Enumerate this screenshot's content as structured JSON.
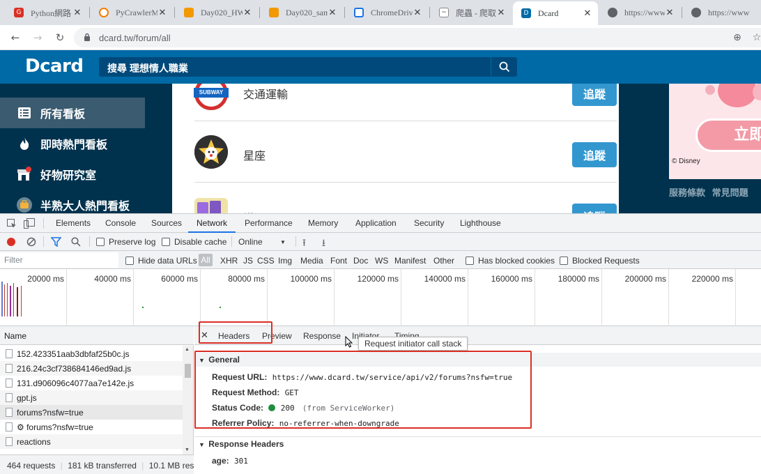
{
  "browser": {
    "tabs": [
      {
        "title": "Python網路",
        "color": "#d93025",
        "glyph": "G"
      },
      {
        "title": "PyCrawlerM",
        "color": "#f57c00",
        "glyph": "C"
      },
      {
        "title": "Day020_HW",
        "color": "#f29900",
        "glyph": "D"
      },
      {
        "title": "Day020_sam",
        "color": "#f29900",
        "glyph": "D"
      },
      {
        "title": "ChromeDriv",
        "color": "#1a73e8",
        "glyph": "□"
      },
      {
        "title": "爬蟲 - 爬取",
        "color": "#5f6368",
        "glyph": "~"
      },
      {
        "title": "Dcard",
        "color": "#006aa6",
        "glyph": "D"
      },
      {
        "title": "https://www",
        "color": "#5f6368",
        "glyph": "◎"
      },
      {
        "title": "https://www",
        "color": "#5f6368",
        "glyph": "◎"
      }
    ],
    "url": "dcard.tw/forum/all"
  },
  "site": {
    "logo": "Dcard",
    "search_value": "搜尋 理想情人職業",
    "sidebar": [
      {
        "label": "所有看板",
        "icon": "list-icon"
      },
      {
        "label": "即時熱門看板",
        "icon": "fire-icon"
      },
      {
        "label": "好物研究室",
        "icon": "shop-icon"
      },
      {
        "label": "半熟大人熱門看板",
        "icon": "briefcase-icon"
      }
    ],
    "forums": [
      {
        "name": "交通運輸",
        "follow": "追蹤",
        "icon": "subway-icon"
      },
      {
        "name": "星座",
        "follow": "追蹤",
        "icon": "zodiac-icon"
      },
      {
        "name": "塔羅",
        "follow": "追蹤",
        "icon": "tarot-icon"
      }
    ],
    "subway_badge": "SUBWAY",
    "ad": {
      "button": "立即",
      "copyright": "© Disney"
    },
    "footer_links": [
      "服務條款",
      "常見問題"
    ]
  },
  "devtools": {
    "tabs": [
      "Elements",
      "Console",
      "Sources",
      "Network",
      "Performance",
      "Memory",
      "Application",
      "Security",
      "Lighthouse"
    ],
    "active_tab": "Network",
    "toolbar": {
      "preserve_log": "Preserve log",
      "disable_cache": "Disable cache",
      "throttle": "Online"
    },
    "filter": {
      "placeholder": "Filter",
      "hide_data_urls": "Hide data URLs",
      "all": "All",
      "types": [
        "XHR",
        "JS",
        "CSS",
        "Img",
        "Media",
        "Font",
        "Doc",
        "WS",
        "Manifest",
        "Other"
      ],
      "has_blocked_cookies": "Has blocked cookies",
      "blocked_requests": "Blocked Requests"
    },
    "timeline_ticks": [
      "20000 ms",
      "40000 ms",
      "60000 ms",
      "80000 ms",
      "100000 ms",
      "120000 ms",
      "140000 ms",
      "160000 ms",
      "180000 ms",
      "200000 ms",
      "220000 ms"
    ],
    "requests_header": "Name",
    "requests": [
      "152.423351aab3dbfaf25b0c.js",
      "216.24c3cf738684146ed9ad.js",
      "131.d906096c4077aa7e142e.js",
      "gpt.js",
      "forums?nsfw=true",
      "⚙ forums?nsfw=true",
      "reactions"
    ],
    "status": {
      "requests": "464 requests",
      "transferred": "181 kB transferred",
      "resources": "10.1 MB res"
    },
    "detail_tabs": [
      "Headers",
      "Preview",
      "Response",
      "Initiator",
      "Timing"
    ],
    "tooltip": "Request initiator call stack",
    "general": {
      "title": "General",
      "request_url_label": "Request URL:",
      "request_url": "https://www.dcard.tw/service/api/v2/forums?nsfw=true",
      "method_label": "Request Method:",
      "method": "GET",
      "status_label": "Status Code:",
      "status": "200",
      "status_note": "(from ServiceWorker)",
      "referrer_label": "Referrer Policy:",
      "referrer": "no-referrer-when-downgrade"
    },
    "response_headers": {
      "title": "Response Headers",
      "age_label": "age:",
      "age": "301"
    }
  }
}
